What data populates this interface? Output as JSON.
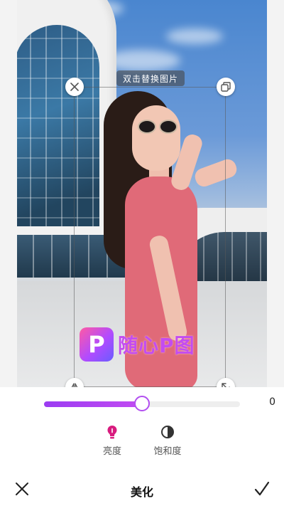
{
  "canvas": {
    "hint_text": "双击替换图片",
    "watermark_logo_letter": "P",
    "watermark_text": "随心P图"
  },
  "handles": {
    "delete": "close-icon",
    "copy": "copy-icon",
    "flip": "flip-icon",
    "resize": "resize-icon"
  },
  "slider": {
    "value": "0",
    "fill_fraction": 0.5,
    "accent": "#b24ef0"
  },
  "tools": [
    {
      "label": "亮度",
      "icon": "brightness-bulb-icon",
      "active": true,
      "color": "#d81b7e"
    },
    {
      "label": "饱和度",
      "icon": "saturation-icon",
      "active": false,
      "color": "#333333"
    }
  ],
  "bottom_bar": {
    "title": "美化",
    "cancel_icon": "close-icon",
    "confirm_icon": "check-icon"
  }
}
